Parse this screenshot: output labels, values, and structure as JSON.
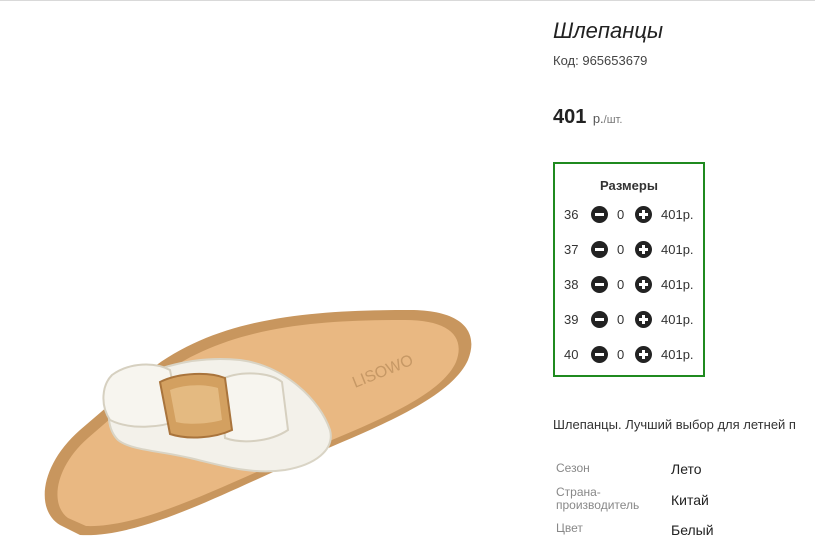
{
  "product": {
    "title": "Шлепанцы",
    "code_label": "Код:",
    "code_value": "965653679",
    "price": "401",
    "currency": "р.",
    "unit": "/шт.",
    "image_brand_text": "LISOWO"
  },
  "sizes": {
    "title": "Размеры",
    "rows": [
      {
        "size": "36",
        "qty": "0",
        "price": "401р."
      },
      {
        "size": "37",
        "qty": "0",
        "price": "401р."
      },
      {
        "size": "38",
        "qty": "0",
        "price": "401р."
      },
      {
        "size": "39",
        "qty": "0",
        "price": "401р."
      },
      {
        "size": "40",
        "qty": "0",
        "price": "401р."
      }
    ]
  },
  "description": "Шлепанцы. Лучший выбор для летней п",
  "properties": [
    {
      "key": "Сезон",
      "value": "Лето"
    },
    {
      "key": "Страна-производитель",
      "value": "Китай"
    },
    {
      "key": "Цвет",
      "value": "Белый"
    }
  ],
  "colors": {
    "border_accent": "#1f8a1f",
    "button": "#222222"
  }
}
